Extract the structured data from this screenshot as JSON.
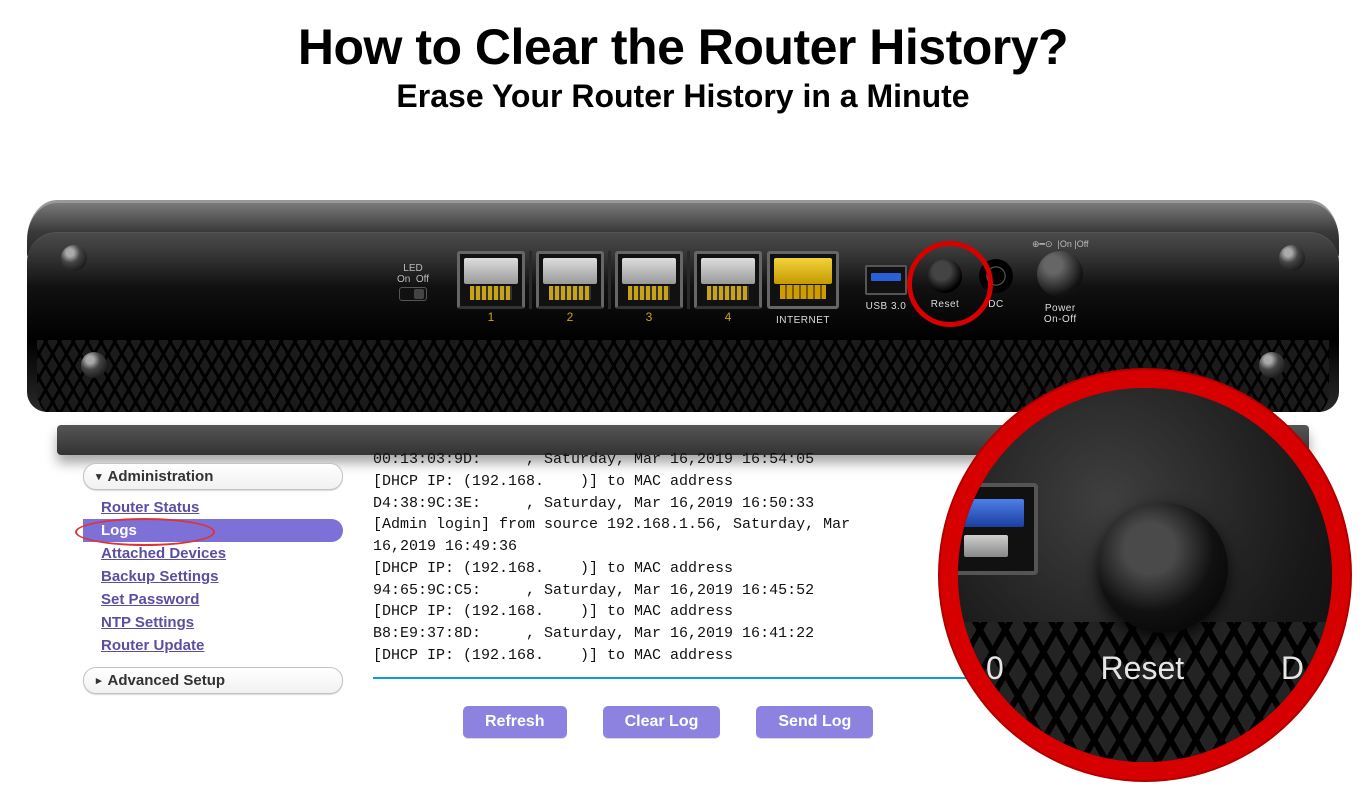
{
  "title": "How to Clear the Router History?",
  "subtitle": "Erase Your Router History in a Minute",
  "router_labels": {
    "led_on": "On",
    "led_off": "Off",
    "led": "LED",
    "port1": "1",
    "port2": "2",
    "port3": "3",
    "port4": "4",
    "internet": "INTERNET",
    "usb": "USB 3.0",
    "reset": "Reset",
    "dc": "DC",
    "power": "Power\nOn-Off",
    "pwr_on": "|On",
    "pwr_off": "|Off"
  },
  "zoom": {
    "left_num": "0",
    "reset": "Reset",
    "right": "D"
  },
  "sidebar": {
    "section_admin": "Administration",
    "section_adv": "Advanced Setup",
    "items": [
      "Router Status",
      "Logs",
      "Attached Devices",
      "Backup Settings",
      "Set Password",
      "NTP Settings",
      "Router Update"
    ]
  },
  "log_lines": [
    "00:13:03:9D:     , Saturday, Mar 16,2019 16:54:05",
    "[DHCP IP: (192.168.    )] to MAC address",
    "D4:38:9C:3E:     , Saturday, Mar 16,2019 16:50:33",
    "[Admin login] from source 192.168.1.56, Saturday, Mar",
    "16,2019 16:49:36",
    "[DHCP IP: (192.168.    )] to MAC address",
    "94:65:9C:C5:     , Saturday, Mar 16,2019 16:45:52",
    "[DHCP IP: (192.168.    )] to MAC address",
    "B8:E9:37:8D:     , Saturday, Mar 16,2019 16:41:22",
    "[DHCP IP: (192.168.    )] to MAC address"
  ],
  "buttons": {
    "refresh": "Refresh",
    "clear": "Clear Log",
    "send": "Send Log"
  }
}
